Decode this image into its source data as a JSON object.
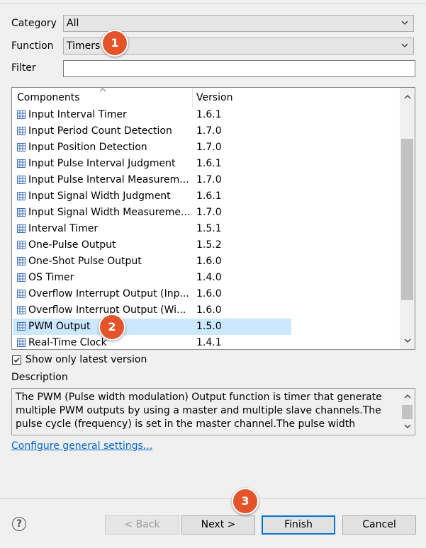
{
  "form": {
    "category_label": "Category",
    "category_value": "All",
    "function_label": "Function",
    "function_value": "Timers",
    "filter_label": "Filter",
    "filter_value": ""
  },
  "components": {
    "col_components": "Components",
    "col_version": "Version",
    "rows": [
      {
        "name": "Input Interval Timer",
        "version": "1.6.1"
      },
      {
        "name": "Input Period Count Detection",
        "version": "1.7.0"
      },
      {
        "name": "Input Position Detection",
        "version": "1.7.0"
      },
      {
        "name": "Input Pulse Interval Judgment",
        "version": "1.6.1"
      },
      {
        "name": "Input Pulse Interval Measurem...",
        "version": "1.7.0"
      },
      {
        "name": "Input Signal Width Judgment",
        "version": "1.6.1"
      },
      {
        "name": "Input Signal Width Measureme...",
        "version": "1.7.0"
      },
      {
        "name": "Interval Timer",
        "version": "1.5.1"
      },
      {
        "name": "One-Pulse Output",
        "version": "1.5.2"
      },
      {
        "name": "One-Shot Pulse Output",
        "version": "1.6.0"
      },
      {
        "name": "OS Timer",
        "version": "1.4.0"
      },
      {
        "name": "Overflow Interrupt Output (Inp...",
        "version": "1.6.0"
      },
      {
        "name": "Overflow Interrupt Output (Wi...",
        "version": "1.6.0"
      },
      {
        "name": "PWM Output",
        "version": "1.5.0"
      },
      {
        "name": "Real-Time Clock",
        "version": "1.4.1"
      }
    ]
  },
  "show_latest_label": "Show only latest version",
  "description_label": "Description",
  "description_text": "The PWM (Pulse width modulation) Output function is timer that generate multiple PWM outputs by using a master and multiple slave channels.The pulse cycle (frequency) is set in the master channel.The pulse width",
  "configure_link": "Configure general settings...",
  "buttons": {
    "help": "?",
    "back": "< Back",
    "next": "Next >",
    "finish": "Finish",
    "cancel": "Cancel"
  },
  "badges": {
    "b1": "1",
    "b2": "2",
    "b3": "3"
  },
  "colors": {
    "badge": "#e5532a",
    "selection": "#cce8ff",
    "link": "#0066cc",
    "default_button_border": "#0078d7"
  }
}
